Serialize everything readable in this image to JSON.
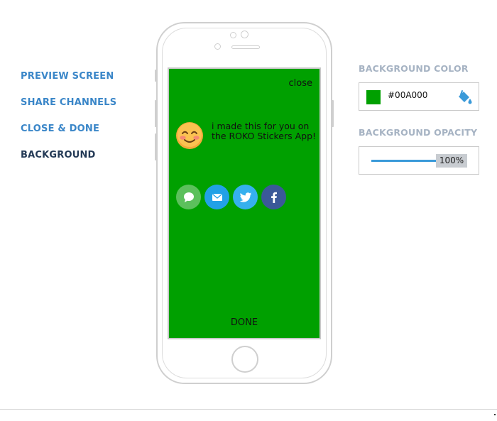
{
  "nav": {
    "items": [
      {
        "label": "PREVIEW SCREEN"
      },
      {
        "label": "SHARE CHANNELS"
      },
      {
        "label": "CLOSE & DONE"
      },
      {
        "label": "BACKGROUND",
        "active": true
      }
    ]
  },
  "preview": {
    "close_label": "close",
    "message": "i made this for you on the ROKO Stickers App!",
    "emoji_icon": "smiling-face-icon",
    "share_channels": [
      {
        "icon": "message-icon",
        "color": "#5CC05C"
      },
      {
        "icon": "mail-icon",
        "color": "#22A1E6"
      },
      {
        "icon": "twitter-icon",
        "color": "#36B0EE"
      },
      {
        "icon": "facebook-icon",
        "color": "#3B5998"
      }
    ],
    "done_label": "DONE",
    "background_color": "#00A000"
  },
  "settings": {
    "background_color_title": "BACKGROUND COLOR",
    "background_color_value": "#00A000",
    "bucket_icon": "paint-bucket-icon",
    "accent_color": "#3A9AD9",
    "background_opacity_title": "BACKGROUND OPACITY",
    "background_opacity_value": "100%",
    "background_opacity_percent": 100
  },
  "colors": {
    "nav_link": "#3A86C8",
    "nav_active": "#243A56",
    "panel_title": "#A6B3C3"
  }
}
